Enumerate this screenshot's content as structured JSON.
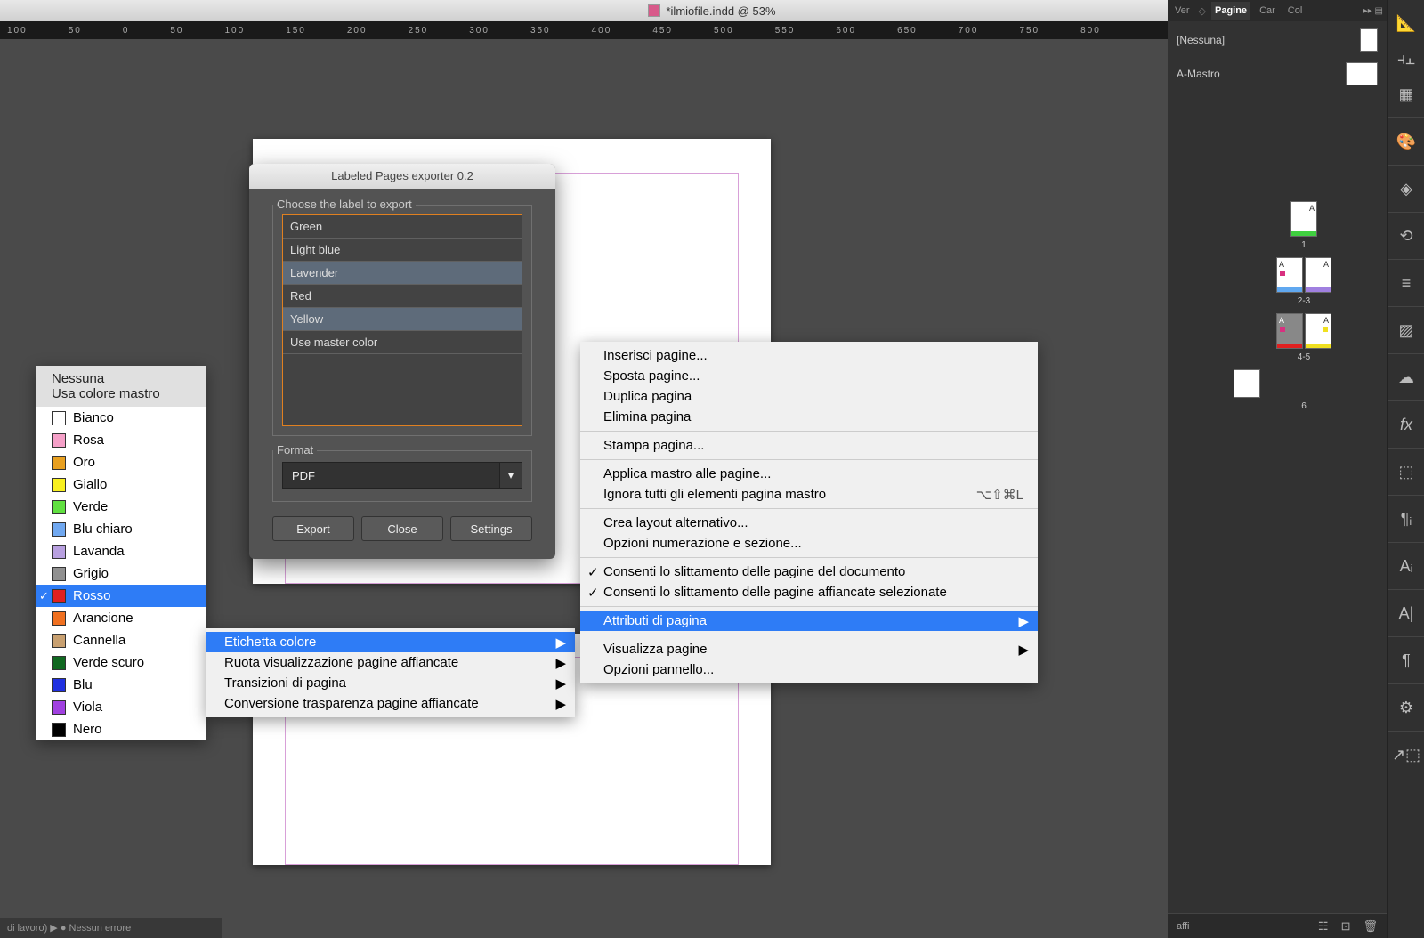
{
  "titlebar": {
    "filename": "*ilmiofile.indd @ 53%"
  },
  "ruler": [
    "100",
    "50",
    "0",
    "50",
    "100",
    "150",
    "200",
    "250",
    "300",
    "350",
    "400",
    "450",
    "500",
    "550",
    "600",
    "650",
    "700",
    "750",
    "800"
  ],
  "exporter": {
    "title": "Labeled Pages exporter 0.2",
    "choose_label": "Choose the label to export",
    "labels": [
      {
        "name": "Green",
        "sel": false
      },
      {
        "name": "Light blue",
        "sel": false
      },
      {
        "name": "Lavender",
        "sel": true
      },
      {
        "name": "Red",
        "sel": false
      },
      {
        "name": "Yellow",
        "sel": true
      },
      {
        "name": "Use master color",
        "sel": false
      }
    ],
    "format_label": "Format",
    "format_value": "PDF",
    "buttons": {
      "export": "Export",
      "close": "Close",
      "settings": "Settings"
    }
  },
  "color_menu": {
    "hdr": [
      "Nessuna",
      "Usa colore mastro"
    ],
    "items": [
      {
        "name": "Bianco",
        "color": "#ffffff"
      },
      {
        "name": "Rosa",
        "color": "#f5a0c8"
      },
      {
        "name": "Oro",
        "color": "#e8a020"
      },
      {
        "name": "Giallo",
        "color": "#f8f020"
      },
      {
        "name": "Verde",
        "color": "#60e040"
      },
      {
        "name": "Blu chiaro",
        "color": "#70a8f0"
      },
      {
        "name": "Lavanda",
        "color": "#b8a0e0"
      },
      {
        "name": "Grigio",
        "color": "#909090"
      },
      {
        "name": "Rosso",
        "color": "#e02020",
        "sel": true
      },
      {
        "name": "Arancione",
        "color": "#f07020"
      },
      {
        "name": "Cannella",
        "color": "#c8a070"
      },
      {
        "name": "Verde scuro",
        "color": "#106820"
      },
      {
        "name": "Blu",
        "color": "#2030e0"
      },
      {
        "name": "Viola",
        "color": "#a040e0"
      },
      {
        "name": "Nero",
        "color": "#000000"
      }
    ]
  },
  "submenu1": {
    "items": [
      {
        "name": "Etichetta colore",
        "sel": true,
        "arr": true
      },
      {
        "name": "Ruota visualizzazione pagine affiancate",
        "arr": true
      },
      {
        "name": "Transizioni di pagina",
        "arr": true
      },
      {
        "name": "Conversione trasparenza pagine affiancate",
        "arr": true
      }
    ]
  },
  "ctxmenu": {
    "g1": [
      "Inserisci pagine...",
      "Sposta pagine...",
      "Duplica pagina",
      "Elimina pagina"
    ],
    "g2": [
      "Stampa pagina..."
    ],
    "g3": [
      {
        "name": "Applica mastro alle pagine..."
      },
      {
        "name": "Ignora tutti gli elementi pagina mastro",
        "sc": "⌥⇧⌘L"
      }
    ],
    "g4": [
      "Crea layout alternativo...",
      "Opzioni numerazione e sezione..."
    ],
    "g5": [
      {
        "name": "Consenti lo slittamento delle pagine del documento",
        "chk": true
      },
      {
        "name": "Consenti lo slittamento delle pagine affiancate selezionate",
        "chk": true
      }
    ],
    "g6": [
      {
        "name": "Attributi di pagina",
        "sel": true,
        "arr": true
      }
    ],
    "g7": [
      {
        "name": "Visualizza pagine",
        "arr": true
      },
      {
        "name": "Opzioni pannello..."
      }
    ]
  },
  "rpanel": {
    "tabs": [
      "Ver",
      "Pagine",
      "Car",
      "Col"
    ],
    "masters": [
      {
        "name": "[Nessuna]"
      },
      {
        "name": "A-Mastro"
      }
    ],
    "footer": "affi",
    "pagenums": [
      "1",
      "2-3",
      "4-5",
      "6"
    ]
  },
  "status": "di lavoro)      ▶  ●  Nessun errore"
}
